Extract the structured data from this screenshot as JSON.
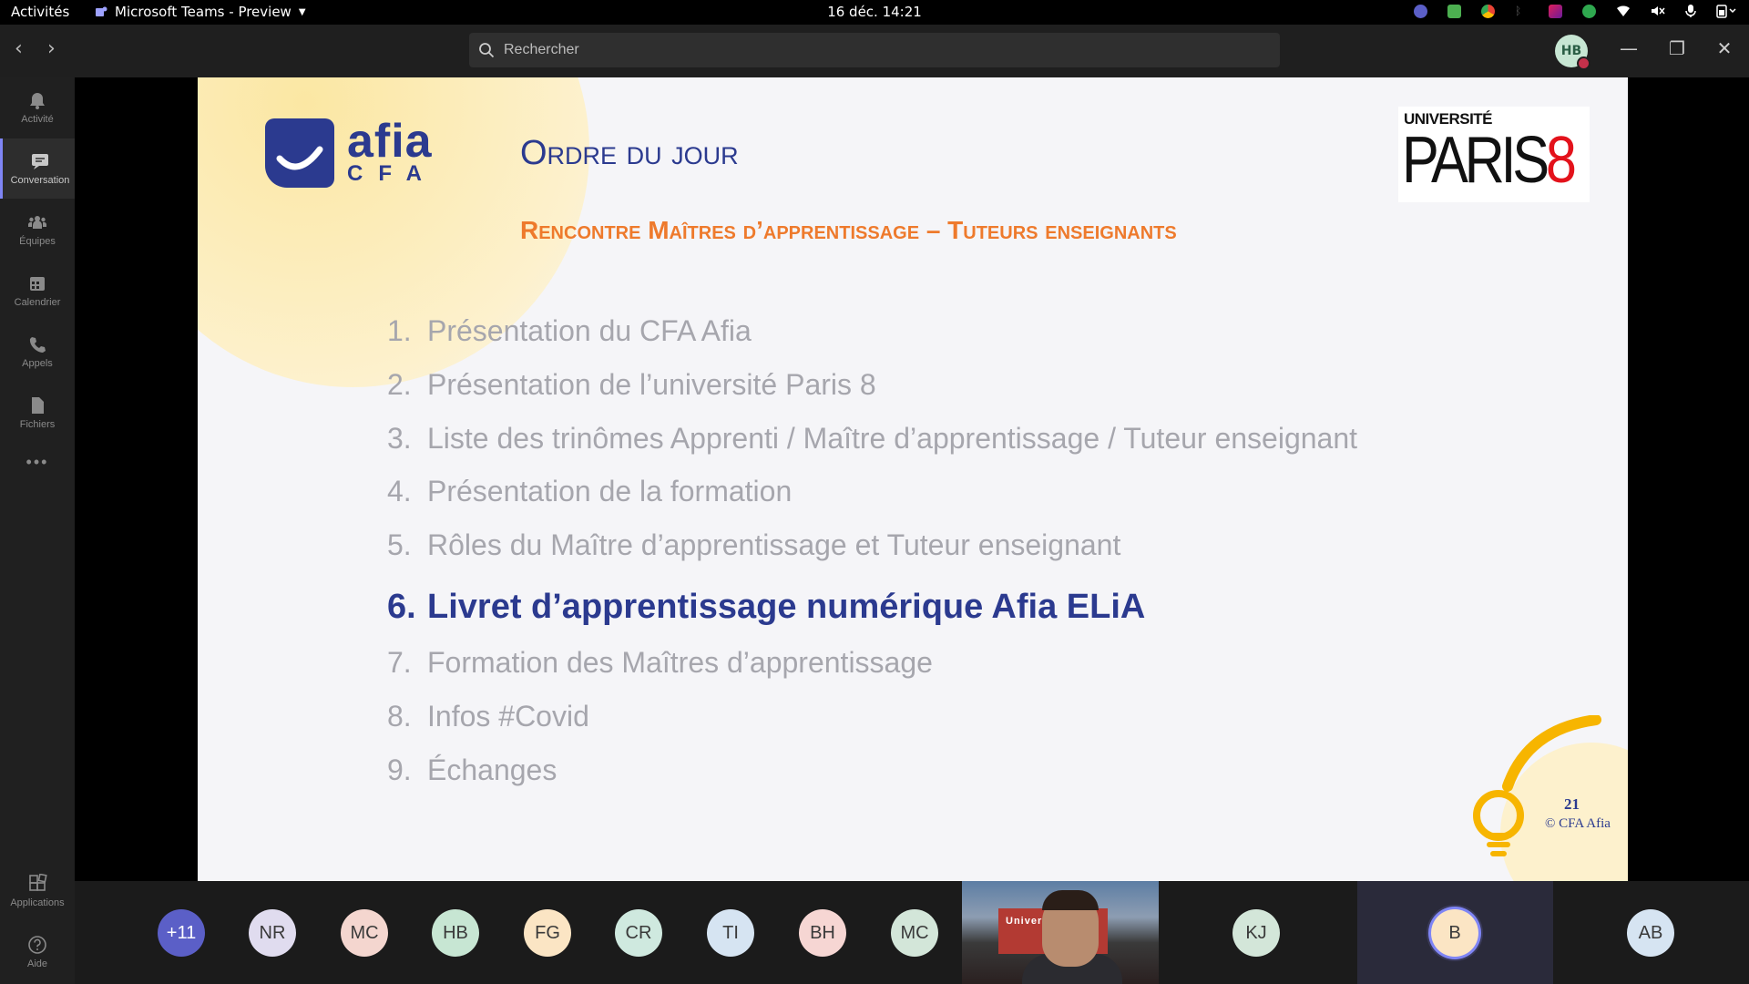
{
  "topbar": {
    "activities": "Activités",
    "app_name": "Microsoft Teams - Preview",
    "clock": "16 déc.  14:21"
  },
  "titlebar": {
    "search_placeholder": "Rechercher",
    "user_initials": "HB"
  },
  "sidebar": {
    "items": [
      {
        "label": "Activité",
        "icon": "bell-icon"
      },
      {
        "label": "Conversation",
        "icon": "chat-icon"
      },
      {
        "label": "Équipes",
        "icon": "teams-icon"
      },
      {
        "label": "Calendrier",
        "icon": "calendar-icon"
      },
      {
        "label": "Appels",
        "icon": "phone-icon"
      },
      {
        "label": "Fichiers",
        "icon": "file-icon"
      },
      {
        "label": "Applications",
        "icon": "apps-icon"
      },
      {
        "label": "Aide",
        "icon": "help-icon"
      }
    ],
    "more": "•••"
  },
  "slide": {
    "logo_afia_top": "afia",
    "logo_afia_bottom": "CFA",
    "title": "Ordre du jour",
    "subtitle": "Rencontre Maîtres d’apprentissage – Tuteurs enseignants",
    "logo_p8_top": "UNIVERSITÉ",
    "logo_p8_word": "PARIS",
    "logo_p8_num": "8",
    "agenda": [
      {
        "num": "1.",
        "text": "Présentation du CFA Afia"
      },
      {
        "num": "2.",
        "text": "Présentation de l’université Paris 8"
      },
      {
        "num": "3.",
        "text": "Liste des trinômes Apprenti / Maître d’apprentissage / Tuteur enseignant"
      },
      {
        "num": "4.",
        "text": "Présentation de la formation"
      },
      {
        "num": "5.",
        "text": "Rôles du Maître d’apprentissage et Tuteur enseignant"
      },
      {
        "num": "6.",
        "text": "Livret d’apprentissage numérique Afia ELiA"
      },
      {
        "num": "7.",
        "text": "Formation des Maîtres d’apprentissage"
      },
      {
        "num": "8.",
        "text": "Infos #Covid"
      },
      {
        "num": "9.",
        "text": "Échanges"
      }
    ],
    "current_item": 6,
    "page_number": "21",
    "copyright": "© CFA Afia"
  },
  "participants": [
    {
      "initials": "+11",
      "bg": "#5b5fc7",
      "fg": "#ffffff"
    },
    {
      "initials": "NR",
      "bg": "#e0dcef",
      "fg": "#3a3a3a"
    },
    {
      "initials": "MC",
      "bg": "#f4d6cf",
      "fg": "#3a3a3a"
    },
    {
      "initials": "HB",
      "bg": "#c7e6d3",
      "fg": "#3a3a3a"
    },
    {
      "initials": "FG",
      "bg": "#fbe5c4",
      "fg": "#3a3a3a"
    },
    {
      "initials": "CR",
      "bg": "#cfe9df",
      "fg": "#3a3a3a"
    },
    {
      "initials": "TI",
      "bg": "#d6e4f2",
      "fg": "#3a3a3a"
    },
    {
      "initials": "BH",
      "bg": "#f6d6d3",
      "fg": "#3a3a3a"
    },
    {
      "initials": "MC",
      "bg": "#d3e6d9",
      "fg": "#3a3a3a"
    },
    {
      "initials": "KJ",
      "bg": "#d3e6d9",
      "fg": "#3a3a3a"
    },
    {
      "initials": "B",
      "bg": "#fbe5c4",
      "fg": "#3a3a3a"
    },
    {
      "initials": "AB",
      "bg": "#d6e4f2",
      "fg": "#3a3a3a"
    }
  ],
  "video_sign": "Univer",
  "colors": {
    "brand_blue": "#2b3a8f",
    "accent_orange": "#ee7a2c",
    "paris8_red": "#e3121b",
    "teams_purple": "#7f85f5"
  }
}
